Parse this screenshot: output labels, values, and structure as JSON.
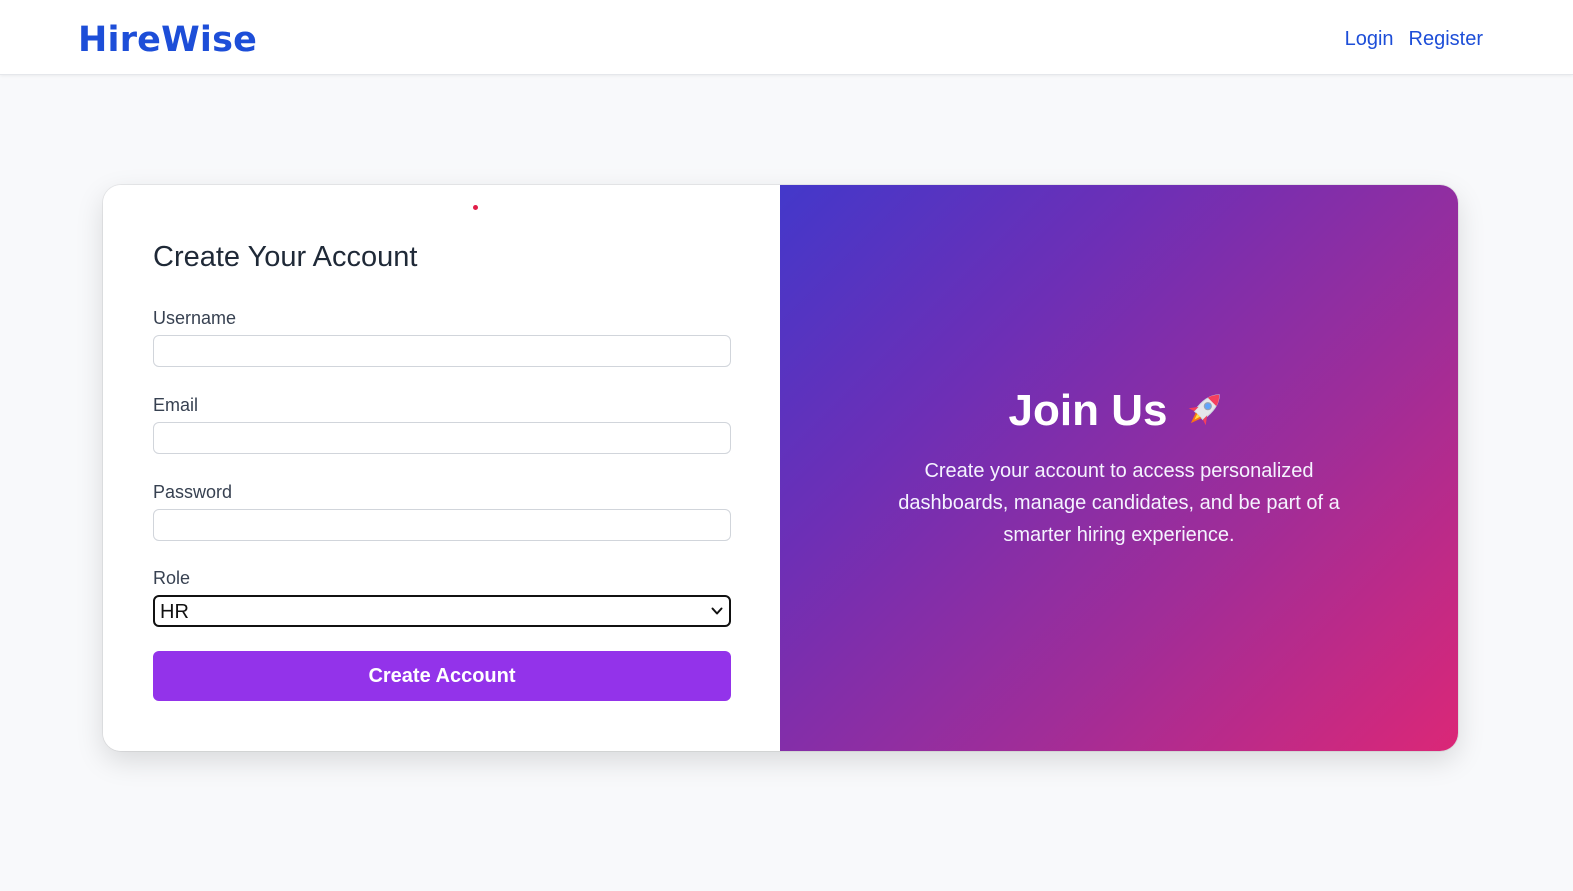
{
  "header": {
    "brand": "HireWise",
    "nav": {
      "login": "Login",
      "register": "Register"
    }
  },
  "form": {
    "title": "Create Your Account",
    "fields": {
      "username": {
        "label": "Username",
        "value": ""
      },
      "email": {
        "label": "Email",
        "value": ""
      },
      "password": {
        "label": "Password",
        "value": ""
      },
      "role": {
        "label": "Role",
        "selected": "HR"
      }
    },
    "submit_label": "Create Account"
  },
  "promo": {
    "title": "Join Us",
    "icon": "rocket-icon",
    "description": "Create your account to access personalized dashboards, manage candidates, and be part of a smarter hiring experience."
  },
  "colors": {
    "brand": "#1d4ed8",
    "button": "#9333ea",
    "gradient_start": "#4338ca",
    "gradient_end": "#db2777"
  }
}
